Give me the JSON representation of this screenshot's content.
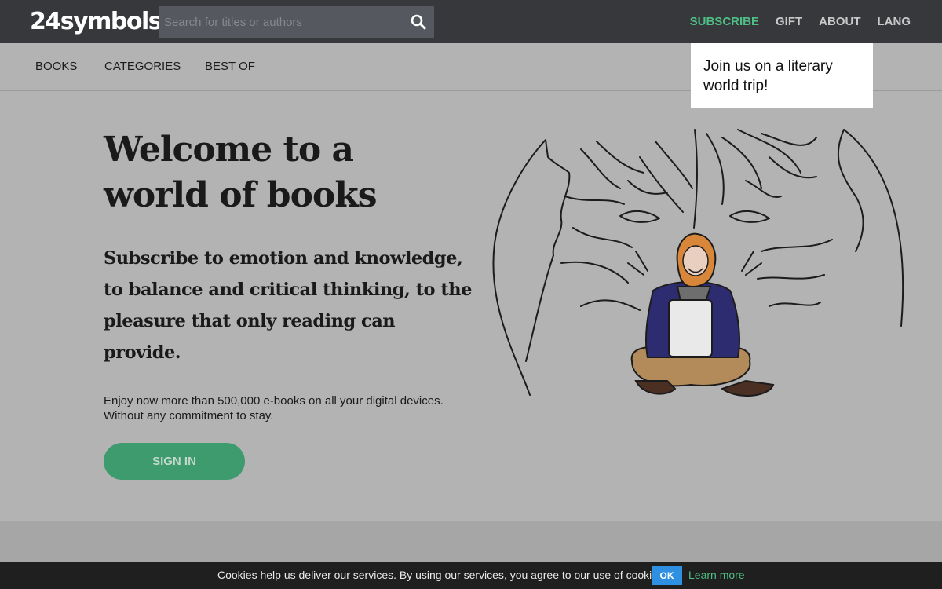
{
  "header": {
    "logo_text": "24symbols",
    "search_placeholder": "Search for titles or authors",
    "nav": {
      "subscribe": "SUBSCRIBE",
      "gift": "GIFT",
      "about": "ABOUT",
      "lang": "LANG"
    }
  },
  "subnav": {
    "books": "BOOKS",
    "categories": "CATEGORIES",
    "best_of": "BEST OF"
  },
  "tooltip": {
    "text": "Join us on a literary world trip!"
  },
  "hero": {
    "title": "Welcome to a world of books",
    "subtitle": "Subscribe to emotion and knowledge, to balance and critical thinking, to the pleasure that only reading can provide.",
    "description_line1": "Enjoy now more than 500,000 e-books on all your digital devices.",
    "description_line2": "Without any commitment to stay.",
    "signin_label": "SIGN IN"
  },
  "cookie_bar": {
    "text": "Cookies help us deliver our services. By using our services, you agree to our use of cookies.",
    "ok_label": "OK",
    "learn_more": "Learn more"
  },
  "colors": {
    "topbar": "#36383c",
    "accent_green": "#4fbf85",
    "button_green": "#3e9b6d",
    "page_background": "#b3b3b3",
    "cookie_ok_blue": "#2f8fe0"
  },
  "icons": {
    "search": "search-icon",
    "illustration": "dragon-reader-illustration"
  }
}
